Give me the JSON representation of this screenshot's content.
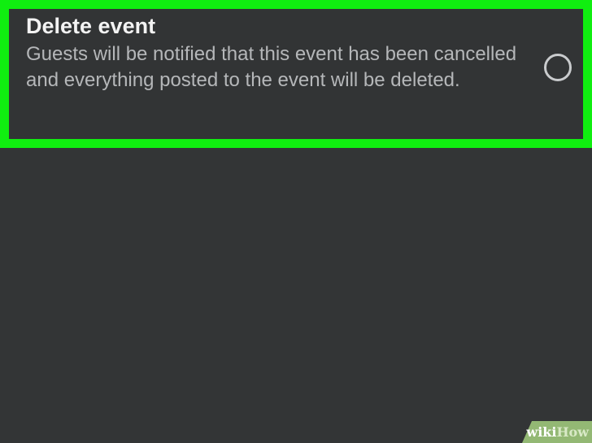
{
  "delete_option": {
    "title": "Delete event",
    "description": "Guests will be notified that this event has been cancelled and everything posted to the event will be deleted.",
    "selected": false
  },
  "colors": {
    "highlight_border": "#10ee10",
    "background": "#333536",
    "title_text": "#f3f3f3",
    "description_text": "#b5b7b9",
    "watermark_bg": "#93b874"
  },
  "watermark": {
    "wiki": "wiki",
    "how": "How"
  }
}
